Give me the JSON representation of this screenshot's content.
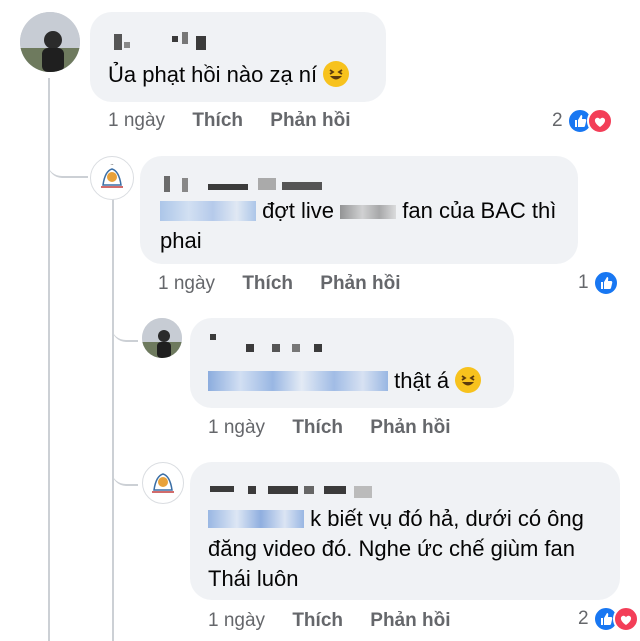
{
  "comments": [
    {
      "text": "Ủa phạt hồi nào zạ ní",
      "time": "1 ngày",
      "like_label": "Thích",
      "reply_label": "Phản hồi",
      "reaction_count": "2",
      "reactions": [
        "like-icon",
        "heart-icon"
      ]
    },
    {
      "text_part": "đợt live",
      "text_part2": "fan của BAC thì",
      "text_line2": "phai",
      "time": "1 ngày",
      "like_label": "Thích",
      "reply_label": "Phản hồi",
      "reaction_count": "1",
      "reactions": [
        "like-icon"
      ]
    },
    {
      "text": "thật á",
      "time": "1 ngày",
      "like_label": "Thích",
      "reply_label": "Phản hồi"
    },
    {
      "text_line1": "k biết vụ đó hả, dưới có ông",
      "text_line2": "đăng video đó. Nghe ức chế giùm fan",
      "text_line3": "Thái luôn",
      "time": "1 ngày",
      "like_label": "Thích",
      "reply_label": "Phản hồi",
      "reaction_count": "2",
      "reactions": [
        "like-icon",
        "heart-icon"
      ]
    }
  ],
  "colors": {
    "bubble": "#f0f2f5",
    "meta_text": "#65676b",
    "like_blue": "#1877f2",
    "heart_red": "#f33e58",
    "thread_line": "#ccd0d5"
  }
}
